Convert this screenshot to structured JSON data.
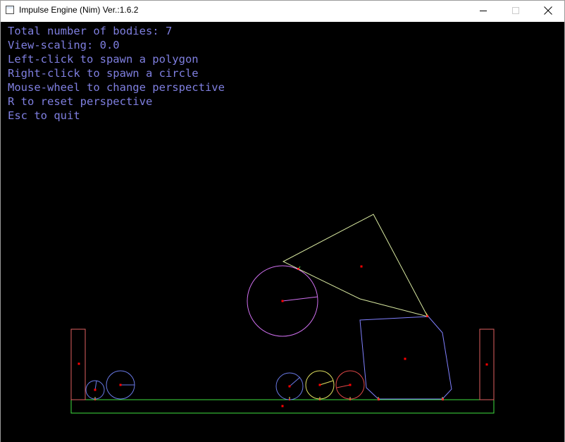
{
  "window": {
    "title": "Impulse Engine (Nim) Ver.:1.6.2",
    "icon": "app-window-icon",
    "controls": [
      "minimize-icon",
      "maximize-icon",
      "close-icon"
    ]
  },
  "hud": {
    "lines": [
      "Total number of bodies: 7",
      "View-scaling: 0.0",
      "Left-click to spawn a polygon",
      "Right-click to spawn a circle",
      "Mouse-wheel to change perspective",
      "R to reset perspective",
      "Esc to quit"
    ]
  },
  "colors": {
    "background": "#000000",
    "hud_text": "#7f7fe0",
    "ground": "#40e040",
    "wall": "#e06060",
    "triangle": "#d8e8a0",
    "big_circle": "#d070f0",
    "box": "#8080ff",
    "circle_blue": "#6a7ae8",
    "circle_yellow": "#e0e060",
    "circle_red": "#e04848",
    "center_marker": "#ff0000",
    "contact_marker": "#ffff00"
  }
}
